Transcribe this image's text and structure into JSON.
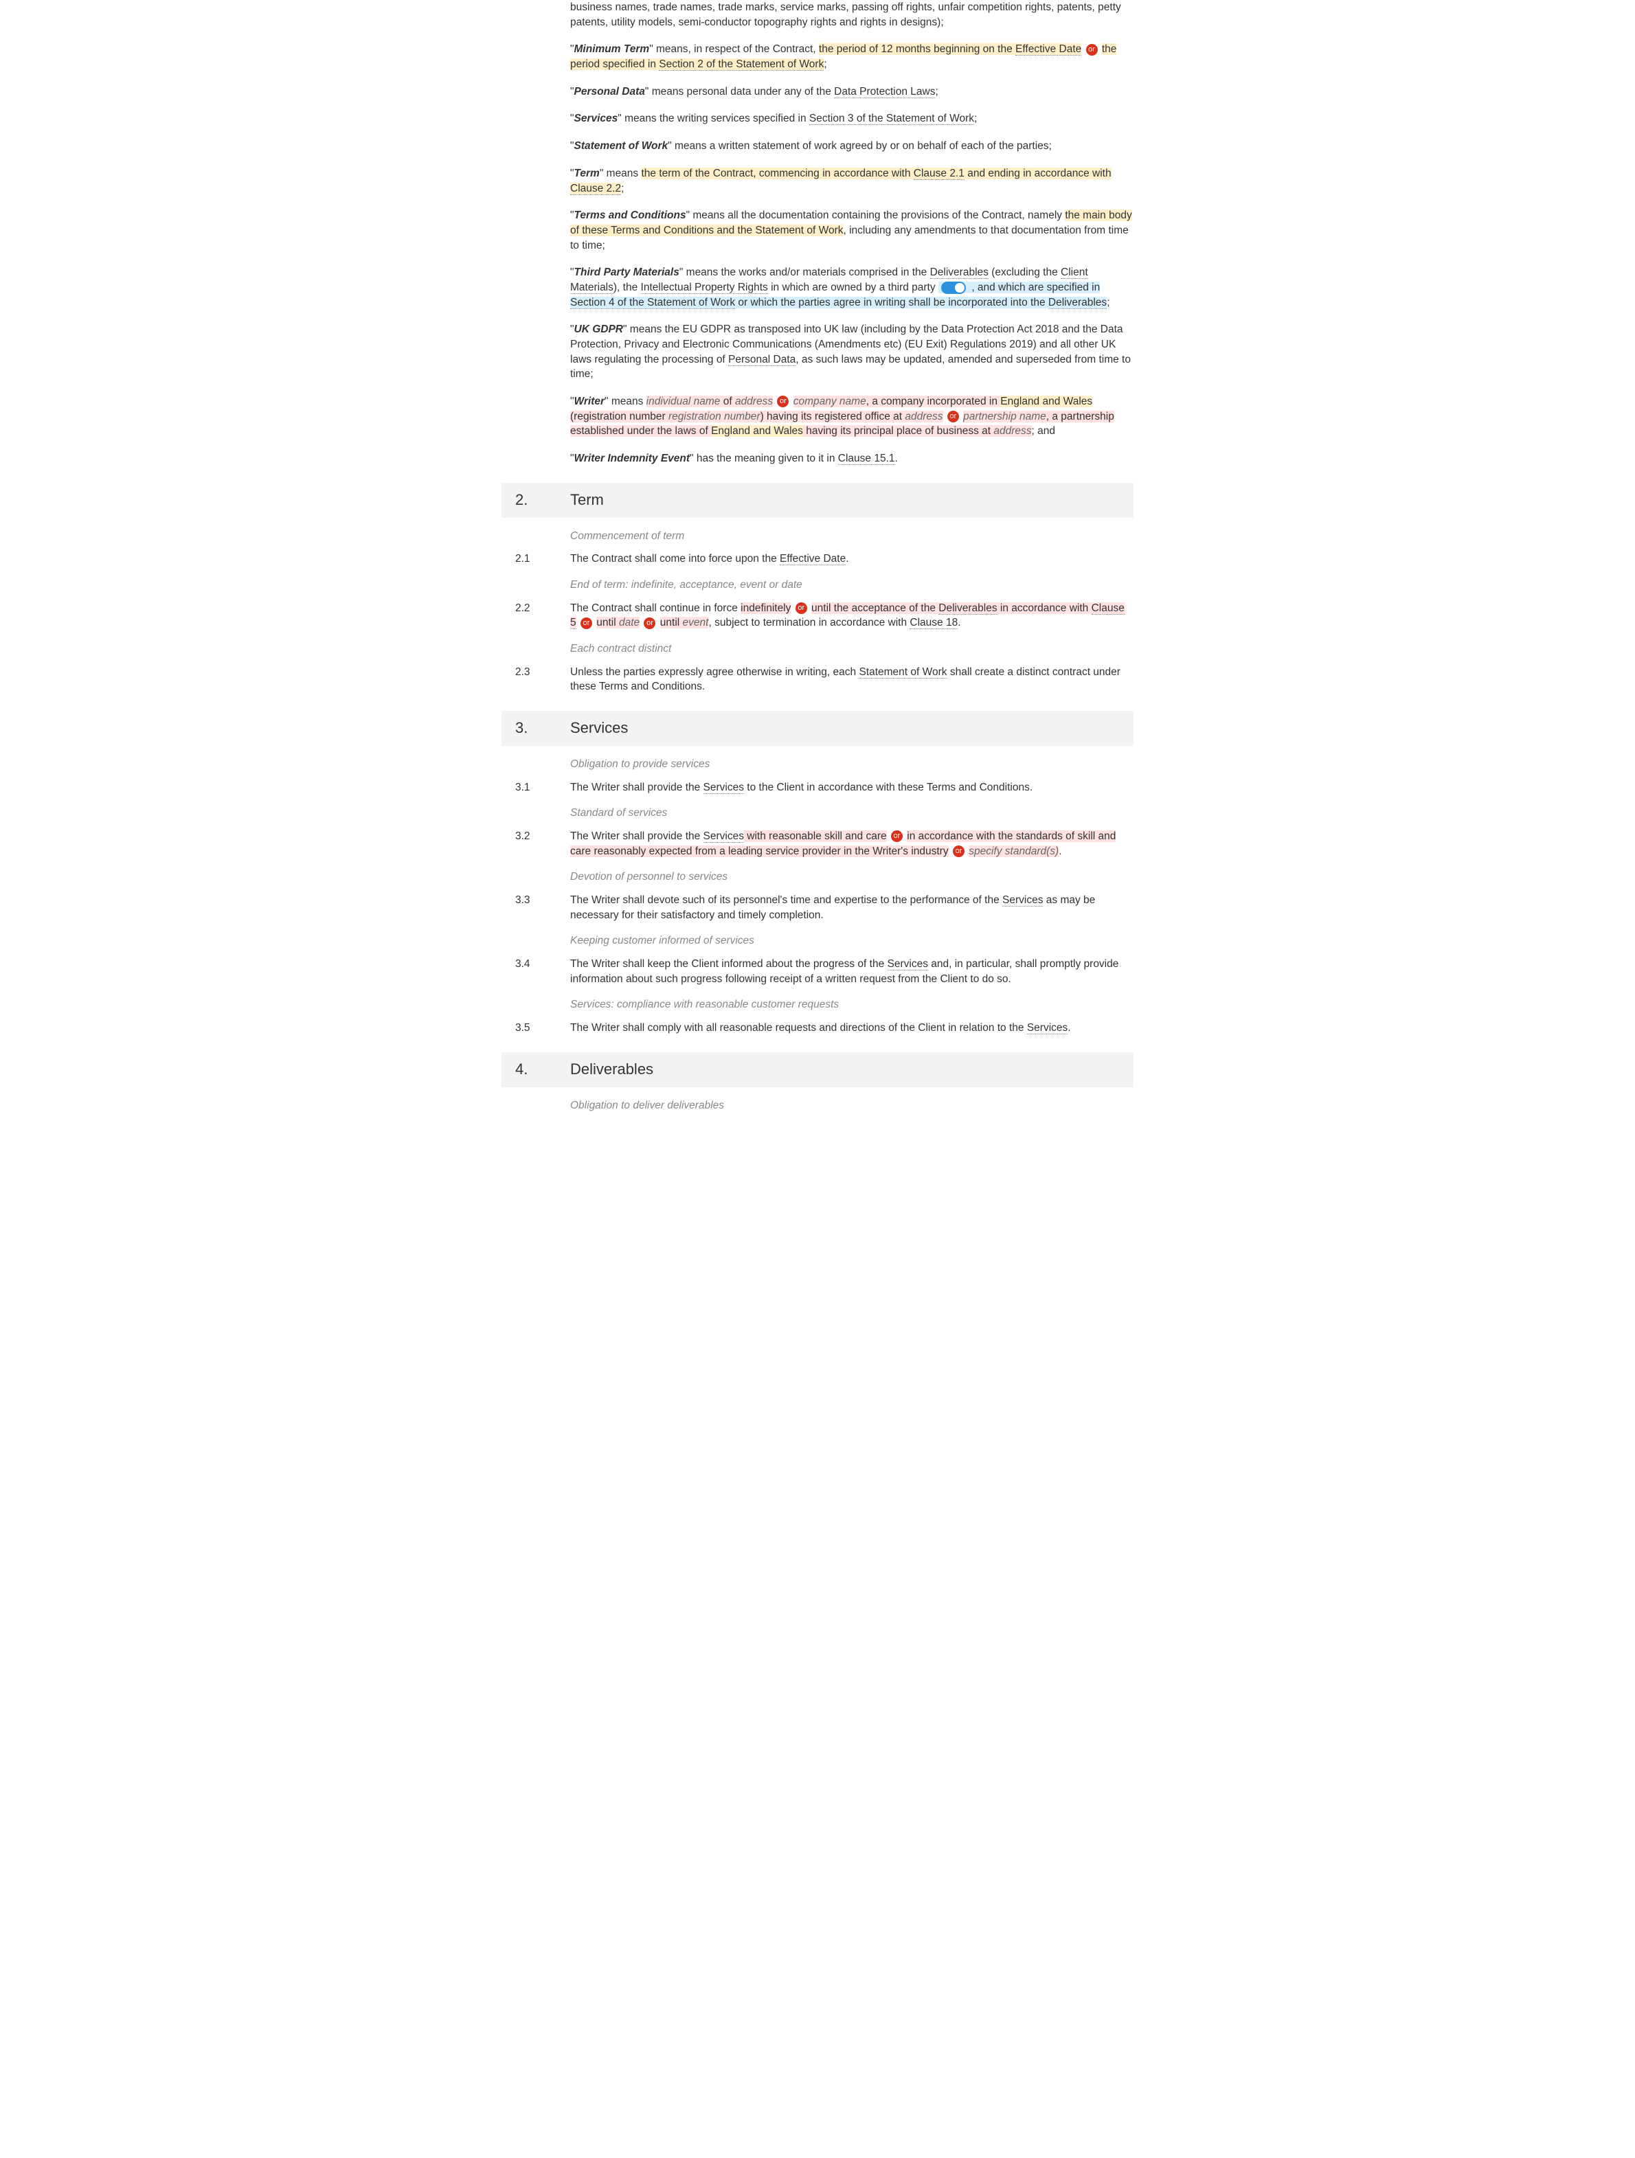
{
  "or_label": "or",
  "definitions": {
    "ip_tail": "business names, trade names, trade marks, service marks, passing off rights, unfair competition rights, patents, petty patents, utility models, semi-conductor topography rights and rights in designs);",
    "minimum_term": {
      "term": "Minimum Term",
      "t1": "\" means, in respect of the Contract, ",
      "y1a": "the period of 12 months beginning on the ",
      "link_eff": "Effective Date",
      "y2": " the period specified in ",
      "link_sec2": "Section 2 of the Statement of Work",
      "tail": ";"
    },
    "personal_data": {
      "term": "Personal Data",
      "t1": "\" means personal data under any of the ",
      "link": "Data Protection Laws",
      "tail": ";"
    },
    "services": {
      "term": "Services",
      "t1": "\" means the writing services specified in ",
      "link": "Section 3 of the Statement of Work",
      "tail": ";"
    },
    "sow": {
      "term": "Statement of Work",
      "t1": "\" means a written statement of work agreed by or on behalf of each of the parties;"
    },
    "term": {
      "term": "Term",
      "t1": "\" means ",
      "y1": "the term of the Contract, commencing in accordance with ",
      "link1": "Clause 2.1",
      "y2": " and ending in accordance with ",
      "link2": "Clause 2.2",
      "tail": ";"
    },
    "tc": {
      "term": "Terms and Conditions",
      "t1": "\" means all the documentation containing the provisions of the Contract, namely ",
      "y1": "the main body of these Terms and Conditions and the Statement of Work",
      "t2": ", including any amendments to that documentation from time to time;"
    },
    "tpm": {
      "term": "Third Party Materials",
      "t1": "\" means the works and/or materials comprised in the ",
      "link_deliv": "Deliverables",
      "t2": " (excluding the ",
      "link_cm": "Client Materials",
      "t3": "), the ",
      "link_ipr": "Intellectual Property Rights",
      "t4": " in which are owned by a third party",
      "b1": ", and which are specified in ",
      "link_sec4": "Section 4 of the Statement of Work",
      "b2": " or which the parties agree in writing shall be incorporated into the ",
      "link_deliv2": "Deliverables",
      "tail": ";"
    },
    "ukgdpr": {
      "term": "UK GDPR",
      "t1": "\" means the EU GDPR as transposed into UK law (including by the Data Protection Act 2018 and the Data Protection, Privacy and Electronic Communications (Amendments etc) (EU Exit) Regulations 2019) and all other UK laws regulating the processing of ",
      "link": "Personal Data",
      "t2": ", as such laws may be updated, amended and superseded from time to time;"
    },
    "writer": {
      "term": "Writer",
      "t1": "\" means ",
      "ph_indiv": "individual name",
      "t2": " of ",
      "ph_addr1": "address",
      "ph_company": "company name",
      "t3": ", a company incorporated in ",
      "y_eng1": "England and Wales",
      "t4": " (registration number ",
      "ph_reg": "registration number",
      "t5": ") having its registered office at ",
      "ph_addr2": "address",
      "ph_partner": "partnership name",
      "t6": ", a partnership established under the laws of ",
      "y_eng2": "England and Wales",
      "t7": " having its principal place of business at ",
      "ph_addr3": "address",
      "tail": "; and"
    },
    "wie": {
      "term": "Writer Indemnity Event",
      "t1": "\" has the meaning given to it in ",
      "link": "Clause 15.1",
      "tail": "."
    }
  },
  "sec2": {
    "num": "2.",
    "title": "Term",
    "note_2_1": "Commencement of term",
    "c21_num": "2.1",
    "c21_a": "The Contract shall come into force upon the ",
    "c21_link": "Effective Date",
    "c21_b": ".",
    "note_2_2": "End of term: indefinite, acceptance, event or date",
    "c22_num": "2.2",
    "c22_a": "The Contract shall continue in force ",
    "c22_y1": "indefinitely",
    "c22_y2a": " until the acceptance of the ",
    "c22_link_deliv": "Deliverables",
    "c22_y2b": " in accordance with ",
    "c22_link_c5": "Clause 5",
    "c22_y3a": " until ",
    "c22_ph_date": "date",
    "c22_y4a": " until ",
    "c22_ph_event": "event",
    "c22_b": ", subject to termination in accordance with ",
    "c22_link_c18": "Clause 18",
    "c22_c": ".",
    "note_2_3": "Each contract distinct",
    "c23_num": "2.3",
    "c23_a": "Unless the parties expressly agree otherwise in writing, each ",
    "c23_link": "Statement of Work",
    "c23_b": " shall create a distinct contract under these Terms and Conditions."
  },
  "sec3": {
    "num": "3.",
    "title": "Services",
    "note_3_1": "Obligation to provide services",
    "c31_num": "3.1",
    "c31_a": "The Writer shall provide the ",
    "c31_link": "Services",
    "c31_b": " to the Client in accordance with these Terms and Conditions.",
    "note_3_2": "Standard of services",
    "c32_num": "3.2",
    "c32_a": "The Writer shall provide the ",
    "c32_link": "Services",
    "c32_y1": " with reasonable skill and care",
    "c32_y2": " in accordance with the standards of skill and care reasonably expected from a leading service provider in the Writer's industry",
    "c32_ph": "specify standard(s)",
    "c32_c": ".",
    "note_3_3": "Devotion of personnel to services",
    "c33_num": "3.3",
    "c33_a": "The Writer shall devote such of its personnel's time and expertise to the performance of the ",
    "c33_link": "Services",
    "c33_b": " as may be necessary for their satisfactory and timely completion.",
    "note_3_4": "Keeping customer informed of services",
    "c34_num": "3.4",
    "c34_a": "The Writer shall keep the Client informed about the progress of the ",
    "c34_link": "Services",
    "c34_b": " and, in particular, shall promptly provide information about such progress following receipt of a written request from the Client to do so.",
    "note_3_5": "Services: compliance with reasonable customer requests",
    "c35_num": "3.5",
    "c35_a": "The Writer shall comply with all reasonable requests and directions of the Client in relation to the ",
    "c35_link": "Services",
    "c35_b": "."
  },
  "sec4": {
    "num": "4.",
    "title": "Deliverables",
    "note_4_1": "Obligation to deliver deliverables"
  }
}
